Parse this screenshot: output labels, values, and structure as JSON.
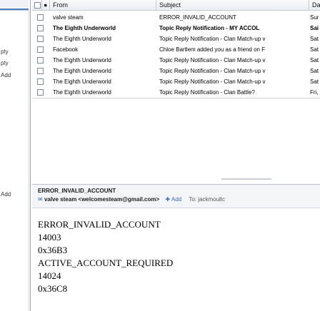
{
  "sidebar": {
    "labels": [
      "pty",
      "pty",
      "Add",
      "Add"
    ]
  },
  "list": {
    "columns": {
      "from": "From",
      "subject": "Subject",
      "date": "Dat"
    },
    "rows": [
      {
        "from": "valve steam",
        "subject": "ERROR_INVALID_ACCOUNT",
        "date": "Sur",
        "bold": false
      },
      {
        "from": "The Eighth Underworld",
        "subject": "Topic Reply Notification - MY ACCOL",
        "date": "Sai",
        "bold": true
      },
      {
        "from": "The Eighth Underworld",
        "subject": "Topic Reply Notification - Clan Match-up v",
        "date": "Sat",
        "bold": false
      },
      {
        "from": "Facebook",
        "subject": "Chloe Bartlem added you as a friend on F",
        "date": "Sat",
        "bold": false
      },
      {
        "from": "The Eighth Underworld",
        "subject": "Topic Reply Notification - Clan Match-up v",
        "date": "Sat",
        "bold": false
      },
      {
        "from": "The Eighth Underworld",
        "subject": "Topic Reply Notification - Clan Match-up v",
        "date": "Sat",
        "bold": false
      },
      {
        "from": "The Eighth Underworld",
        "subject": "Topic Reply Notification - Clan Match-up v",
        "date": "Sat",
        "bold": false
      },
      {
        "from": "The Eighth Underworld",
        "subject": "Topic Reply Notification - Clan Battle?",
        "date": "Fri,",
        "bold": false
      }
    ]
  },
  "preview": {
    "subject": "ERROR_INVALID_ACCOUNT",
    "from_name": "valve steam <welcomesteam@gmail.com>",
    "add_label": "Add",
    "to_label": "To: jackmoultc",
    "body_lines": [
      "ERROR_INVALID_ACCOUNT",
      "14003",
      "0x36B3",
      "ACTIVE_ACCOUNT_REQUIRED",
      "14024",
      "0x36C8"
    ]
  },
  "colors": {
    "accent": "#4c7fb8",
    "link": "#3a6fb0"
  }
}
